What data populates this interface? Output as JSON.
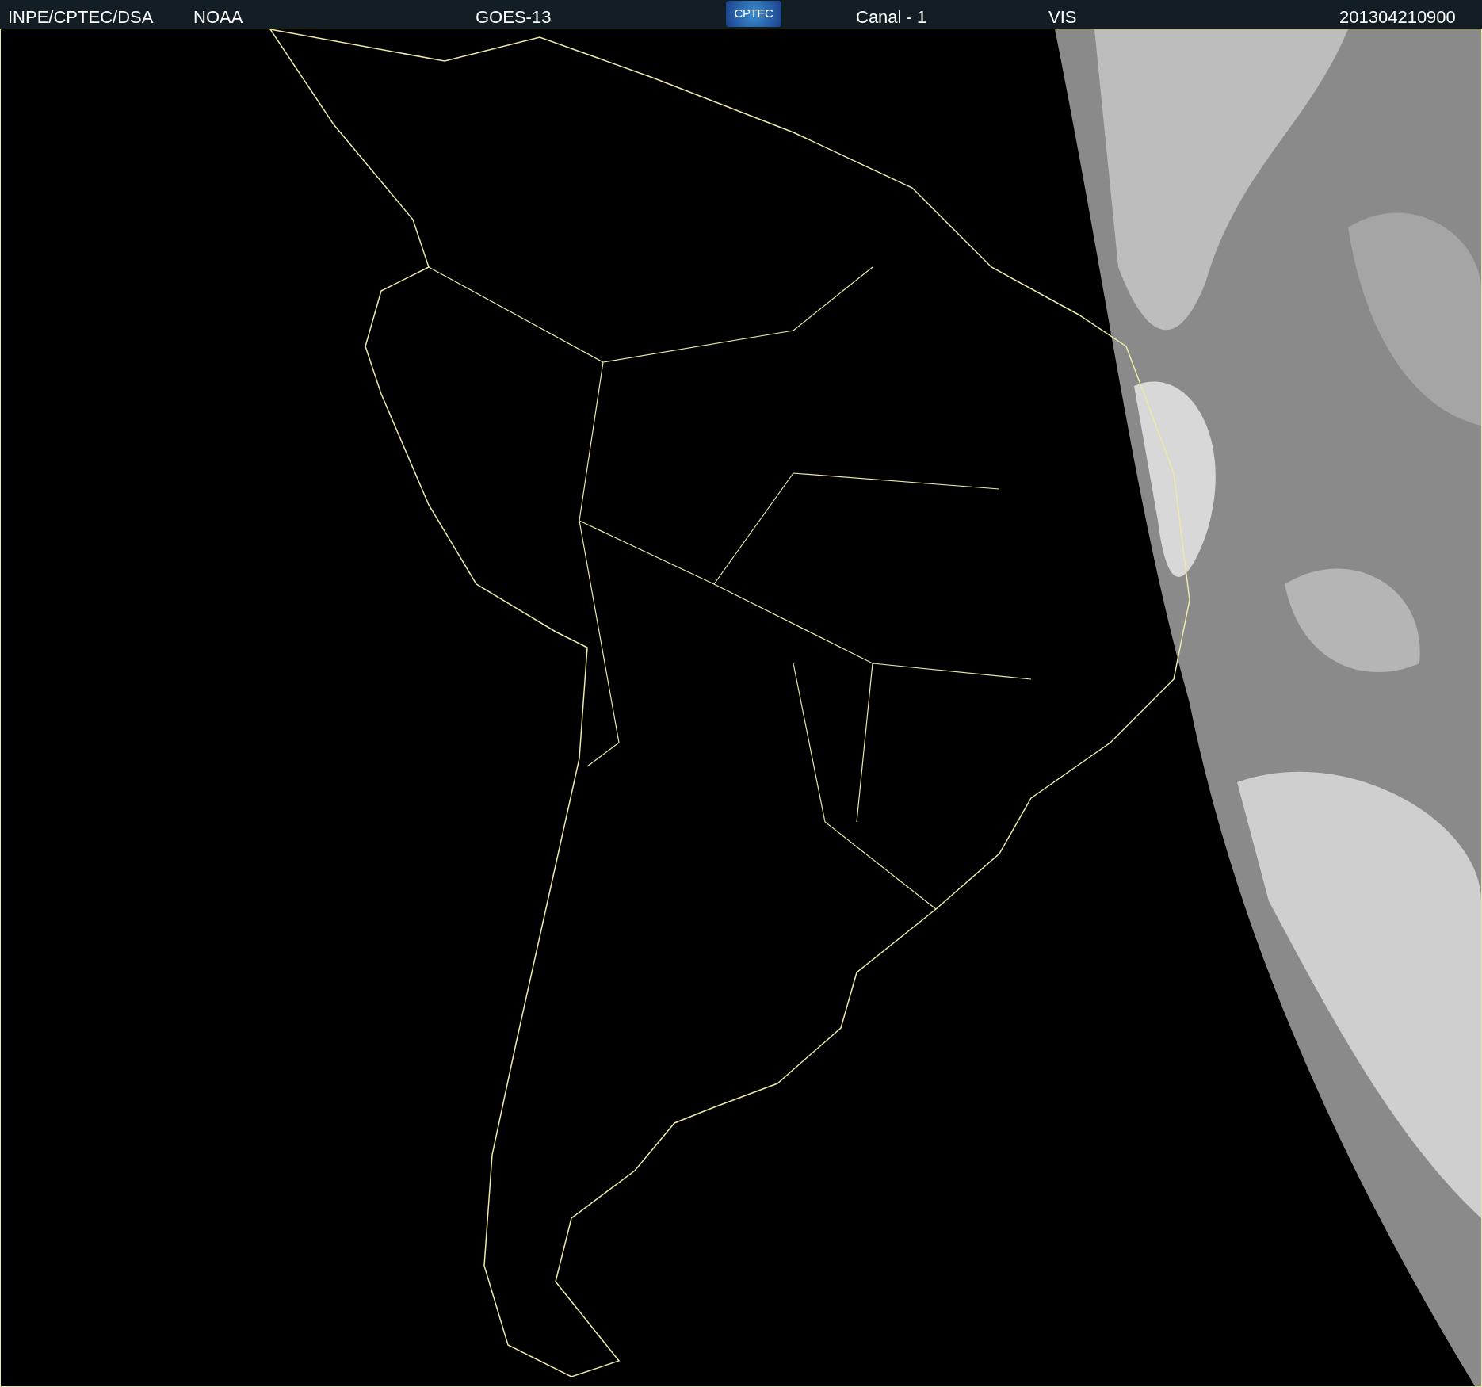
{
  "header": {
    "source": "INPE/CPTEC/DSA",
    "agency": "NOAA",
    "satellite": "GOES-13",
    "logo": "CPTEC",
    "channel": "Canal - 1",
    "band": "VIS",
    "timestamp": "201304210900"
  }
}
